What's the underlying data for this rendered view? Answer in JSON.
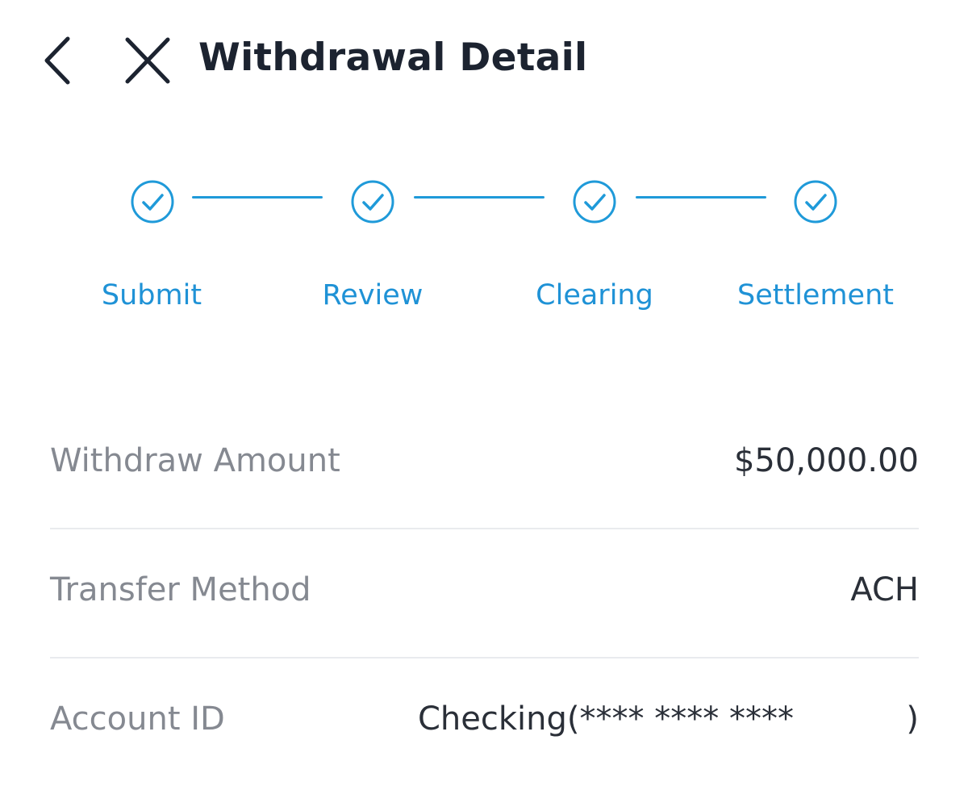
{
  "header": {
    "title": "Withdrawal Detail",
    "back_icon": "chevron-left-icon",
    "close_icon": "close-icon"
  },
  "stepper": {
    "accent_color": "#1f9ad9",
    "steps": [
      {
        "label": "Submit",
        "status": "complete",
        "icon": "check-circle-icon"
      },
      {
        "label": "Review",
        "status": "complete",
        "icon": "check-circle-icon"
      },
      {
        "label": "Clearing",
        "status": "complete",
        "icon": "check-circle-icon"
      },
      {
        "label": "Settlement",
        "status": "complete",
        "icon": "check-circle-icon"
      }
    ]
  },
  "details": {
    "amount": {
      "label": "Withdraw Amount",
      "value": "$50,000.00"
    },
    "method": {
      "label": "Transfer Method",
      "value": "ACH"
    },
    "account": {
      "label": "Account ID",
      "value_prefix": "Checking(**** **** ****",
      "value_suffix": ")"
    }
  }
}
